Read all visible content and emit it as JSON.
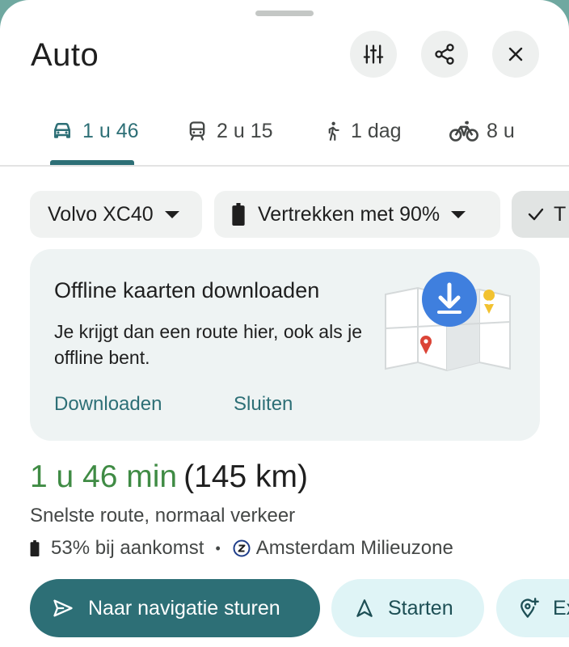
{
  "header": {
    "title": "Auto"
  },
  "tabs": [
    {
      "label": "1 u 46",
      "icon": "car-icon",
      "active": true
    },
    {
      "label": "2 u 15",
      "icon": "train-icon",
      "active": false
    },
    {
      "label": "1 dag",
      "icon": "walking-icon",
      "active": false
    },
    {
      "label": "8 u",
      "icon": "bicycle-icon",
      "active": false
    }
  ],
  "chips": {
    "vehicle": "Volvo XC40",
    "battery": "Vertrekken met 90%",
    "toll": "T"
  },
  "offline_card": {
    "title": "Offline kaarten downloaden",
    "body": "Je krijgt dan een route hier, ook als je offline bent.",
    "download_label": "Downloaden",
    "close_label": "Sluiten"
  },
  "route": {
    "time": "1 u 46 min",
    "distance": "(145 km)",
    "description": "Snelste route, normaal verkeer",
    "arrival_battery": "53% bij aankomst",
    "separator": "•",
    "zone": "Amsterdam Milieuzone"
  },
  "actions": {
    "send_to_nav": "Naar navigatie sturen",
    "start": "Starten",
    "extra": "Ex"
  },
  "colors": {
    "accent": "#2d6f76",
    "duration_green": "#3f8b44",
    "card_bg": "#eef3f3",
    "secondary_btn": "#dff4f6"
  }
}
